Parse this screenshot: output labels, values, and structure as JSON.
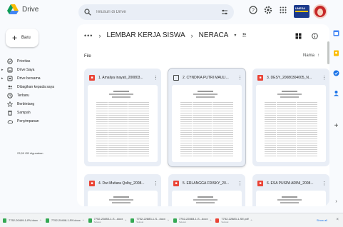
{
  "app": {
    "name": "Drive"
  },
  "search": {
    "placeholder": "Telusuri di Drive"
  },
  "header": {
    "badge_text": "UNESA"
  },
  "sidebar": {
    "new_label": "Baru",
    "items": [
      {
        "label": "Prioritas",
        "icon": "priority-icon",
        "caret": false
      },
      {
        "label": "Drive Saya",
        "icon": "my-drive-icon",
        "caret": true
      },
      {
        "label": "Drive bersama",
        "icon": "shared-drive-icon",
        "caret": true
      },
      {
        "label": "Dibagikan kepada saya",
        "icon": "shared-with-me-icon",
        "caret": false
      },
      {
        "label": "Terbaru",
        "icon": "recent-icon",
        "caret": false
      },
      {
        "label": "Berbintang",
        "icon": "star-icon",
        "caret": false
      },
      {
        "label": "Sampah",
        "icon": "trash-icon",
        "caret": false
      },
      {
        "label": "Penyimpanan",
        "icon": "cloud-icon",
        "caret": false
      }
    ],
    "storage_text": "23,59 GB digunakan"
  },
  "breadcrumb": {
    "overflow": "•••",
    "parent": "LEMBAR KERJA SISWA",
    "current": "NERACA"
  },
  "files_section": {
    "label": "File",
    "sort_label": "Nama",
    "sort_dir": "↑"
  },
  "files": [
    {
      "name": "1. Amaliya inayati_200803...",
      "selected": false,
      "type": "pdf"
    },
    {
      "name": "2. CYNDIKA PUTRI MAULI...",
      "selected": true,
      "type": "doc"
    },
    {
      "name": "3. DESY_20080304005_N...",
      "selected": false,
      "type": "pdf"
    },
    {
      "name": "4. Dwi Mutiara Qolby_2008...",
      "selected": false,
      "type": "pdf"
    },
    {
      "name": "5. ERLANGGA FRISKY_20...",
      "selected": false,
      "type": "pdf"
    },
    {
      "name": "6. ESA PUSPA ARINI_2008...",
      "selected": false,
      "type": "pdf"
    }
  ],
  "downloads": [
    {
      "name": "7752-20409-1-RV.docx",
      "sub": "",
      "type": "doc"
    },
    {
      "name": "7752-20408-1-RV.docx",
      "sub": "",
      "type": "doc"
    },
    {
      "name": "7752-22883-1-S...docx",
      "sub": "Selesai",
      "type": "doc"
    },
    {
      "name": "7752-22883-1-S...docx",
      "sub": "Selesai",
      "type": "doc"
    },
    {
      "name": "7752-22883-1-S...docx",
      "sub": "Selesai",
      "type": "doc"
    },
    {
      "name": "7752-22883-1-SE.pdf",
      "sub": "Selesai",
      "type": "pdf"
    }
  ],
  "downloads_show_all": "Show all",
  "colors": {
    "accent": "#1a73e8",
    "pdf_red": "#ea4335",
    "panel_bg": "#f8fafd"
  }
}
